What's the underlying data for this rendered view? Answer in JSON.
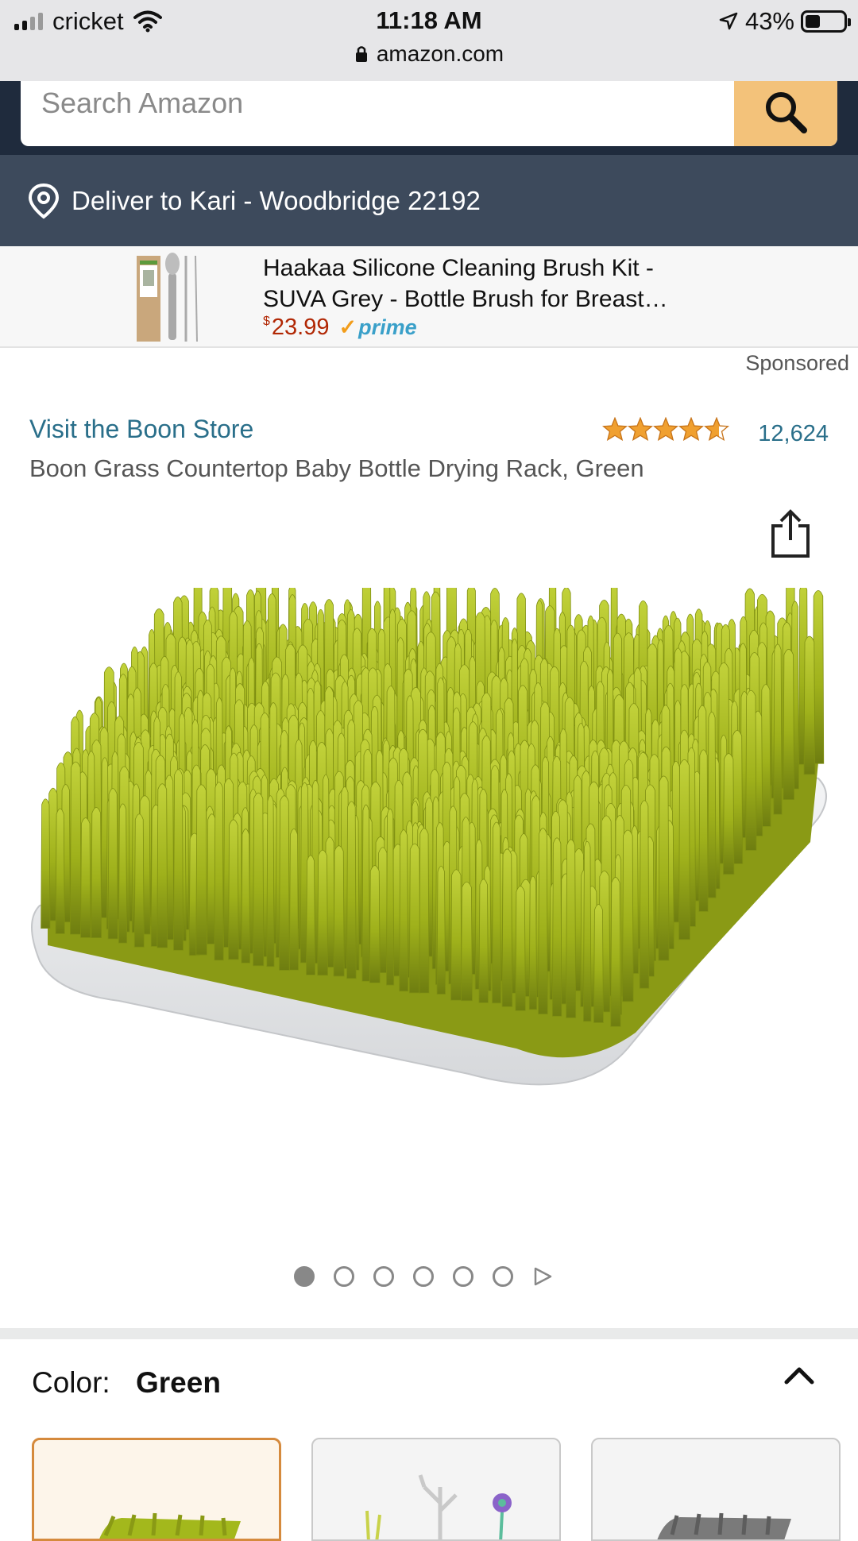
{
  "status_bar": {
    "carrier": "cricket",
    "time": "11:18 AM",
    "battery": "43%",
    "url": "amazon.com"
  },
  "search": {
    "placeholder": "Search Amazon"
  },
  "deliver": {
    "text": "Deliver to Kari - Woodbridge 22192"
  },
  "sponsored_banner": {
    "title_line1": "Haakaa Silicone Cleaning Brush Kit -",
    "title_line2": "SUVA Grey - Bottle Brush for Breast…",
    "currency": "$",
    "price": "23.99",
    "prime": "prime",
    "label": "Sponsored"
  },
  "product": {
    "store_link": "Visit the Boon Store",
    "rating_stars": 4.5,
    "rating_count": "12,624",
    "title": "Boon Grass Countertop Baby Bottle Drying Rack, Green",
    "image_count": 6,
    "active_image": 1
  },
  "color": {
    "label": "Color:",
    "value": "Green"
  },
  "colors": {
    "accent_link": "#2a6f8a",
    "price_red": "#b12704",
    "search_orange": "#f3c27a",
    "header_navy": "#1f2b3d",
    "deliver_bg": "#3d4a5c",
    "star_orange": "#f0a030",
    "grass_green": "#a3b81c"
  }
}
